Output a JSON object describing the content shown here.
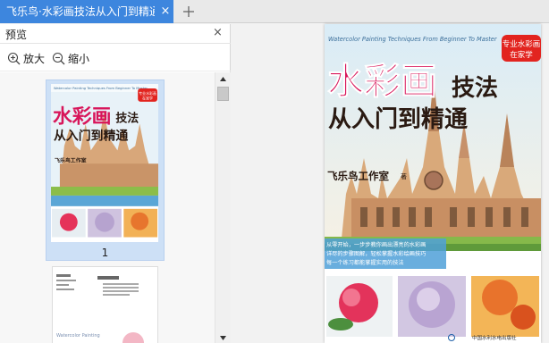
{
  "tab": {
    "title": "飞乐鸟·水彩画技法从入门到精通",
    "close_glyph": "×",
    "new_glyph": "+"
  },
  "preview": {
    "title": "预览",
    "close_glyph": "×",
    "zoom_in": "放大",
    "zoom_out": "缩小",
    "page_number": "1"
  },
  "cover": {
    "series_en": "Watercolor Painting Techniques From Beginner To Master",
    "badge_line1": "专业水彩画",
    "badge_line2": "在家学",
    "title_main": "水彩画",
    "title_side": "技法",
    "title_sub": "从入门到精通",
    "author": "飞乐鸟工作室",
    "author_suffix": "著",
    "desc_line1": "从零开始，一步步教你画出漂亮的水彩画",
    "desc_line2": "详尽的步骤图解，轻松掌握水彩绘画技巧",
    "desc_line3": "每一个练习都能掌握实用的技法",
    "publisher": "中国水利水电出版社"
  },
  "page2": {
    "series_en": "Watercolor Painting"
  },
  "colors": {
    "tab_active": "#3d86de",
    "title_red": "#d8155a",
    "title_dark": "#2a1a12",
    "badge_red": "#e2241f",
    "sky_blue": "#d9ecf7",
    "selection": "#cde0f6"
  }
}
